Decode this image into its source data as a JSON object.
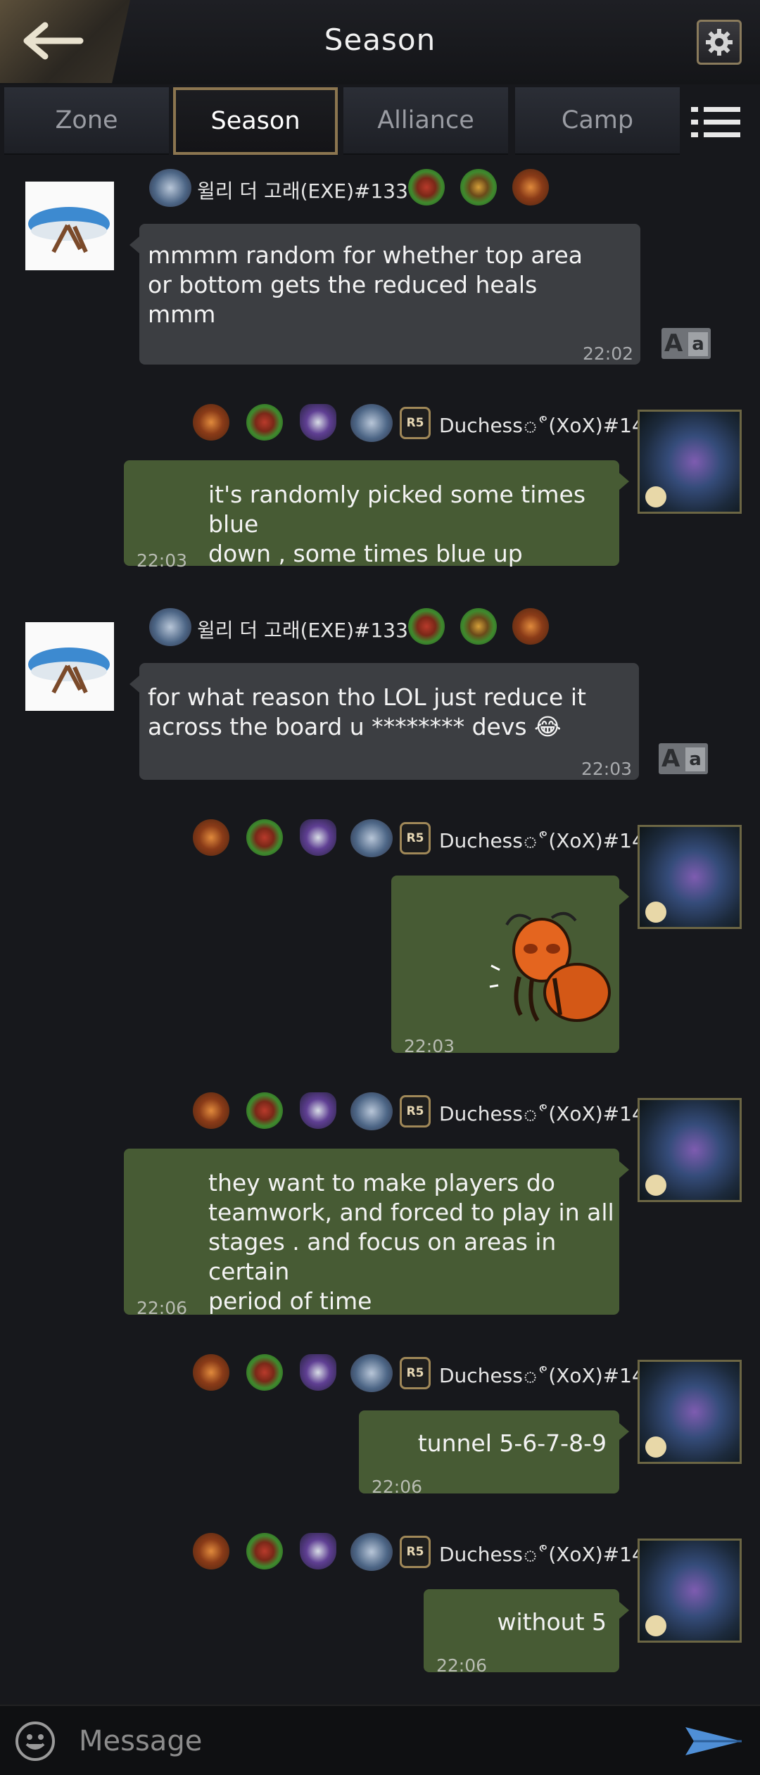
{
  "header": {
    "title": "Season",
    "back_icon": "back-arrow-icon",
    "settings_icon": "gear-icon"
  },
  "tabs": [
    {
      "label": "Zone",
      "active": false
    },
    {
      "label": "Season",
      "active": true
    },
    {
      "label": "Alliance",
      "active": false
    },
    {
      "label": "Camp",
      "active": false
    }
  ],
  "menu_icon": "list-menu-icon",
  "messages": [
    {
      "side": "left",
      "user": "윌리 더 고래(EXE)#133",
      "text": "mmmm random for whether top area\nor bottom gets the reduced heals\nmmm",
      "time": "22:02",
      "translate_label_big": "A",
      "translate_label_small": "a"
    },
    {
      "side": "right",
      "user": "Duchessீ(XoX)#14",
      "rank": "R5",
      "text": "it's randomly picked some times blue\ndown , some times blue up",
      "time": "22:03"
    },
    {
      "side": "left",
      "user": "윌리 더 고래(EXE)#133",
      "text": "for what reason tho LOL just reduce it\n across the board u ******** devs 😂",
      "time": "22:03",
      "translate_label_big": "A",
      "translate_label_small": "a"
    },
    {
      "side": "right",
      "user": "Duchessீ(XoX)#14",
      "rank": "R5",
      "sticker": "ant-sticker",
      "time": "22:03"
    },
    {
      "side": "right",
      "user": "Duchessீ(XoX)#14",
      "rank": "R5",
      "text": "they want to make players do\nteamwork, and forced to play in all\nstages . and focus on areas in certain\n period of time",
      "time": "22:06"
    },
    {
      "side": "right",
      "user": "Duchessீ(XoX)#14",
      "rank": "R5",
      "text": "tunnel 5-6-7-8-9",
      "time": "22:06"
    },
    {
      "side": "right",
      "user": "Duchessீ(XoX)#14",
      "rank": "R5",
      "text": "without 5",
      "time": "22:06"
    }
  ],
  "composer": {
    "placeholder": "Message",
    "emoji_icon": "smiley-icon",
    "send_icon": "send-arrow-icon"
  }
}
